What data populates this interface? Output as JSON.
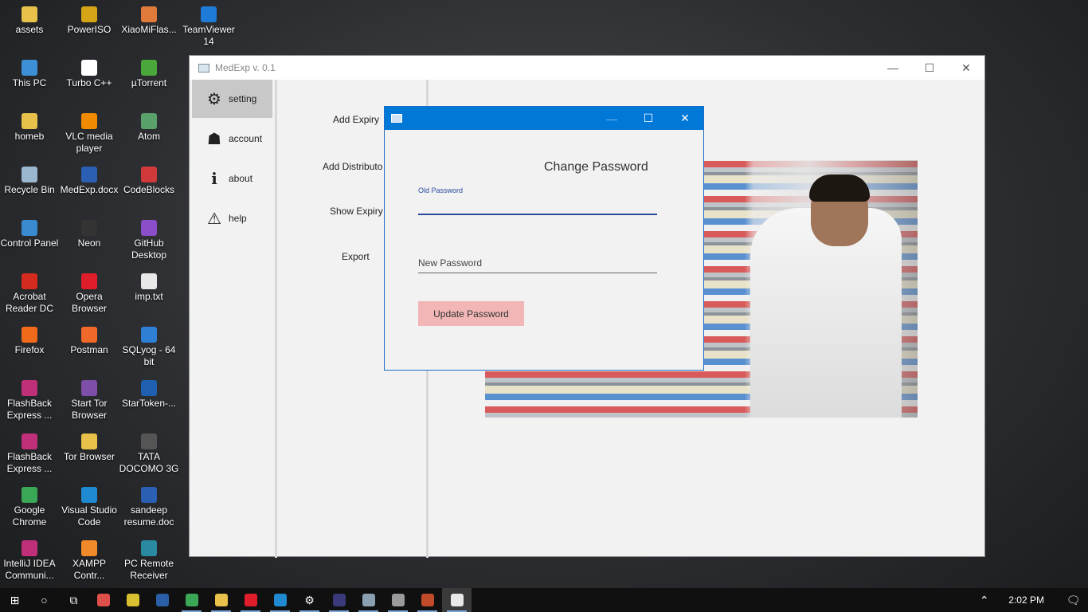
{
  "desktop": {
    "icons": [
      {
        "label": "assets",
        "color": "#e8c14a"
      },
      {
        "label": "PowerISO",
        "color": "#d6a417"
      },
      {
        "label": "XiaoMiFlas...",
        "color": "#e07a3a"
      },
      {
        "label": "TeamViewer 14",
        "color": "#1e7bd8"
      },
      {
        "label": "This PC",
        "color": "#3d8fd6"
      },
      {
        "label": "Turbo C++",
        "color": "#ffffff"
      },
      {
        "label": "µTorrent",
        "color": "#4aa83a"
      },
      {
        "label": "homeb",
        "color": "#e8c14a"
      },
      {
        "label": "VLC media player",
        "color": "#f08a00"
      },
      {
        "label": "Atom",
        "color": "#5aa06a"
      },
      {
        "label": "Recycle Bin",
        "color": "#9bb7cf"
      },
      {
        "label": "MedExp.docx",
        "color": "#2b5fb4"
      },
      {
        "label": "CodeBlocks",
        "color": "#d03a3a"
      },
      {
        "label": "Control Panel",
        "color": "#3a8ad0"
      },
      {
        "label": "Neon",
        "color": "#333333"
      },
      {
        "label": "GitHub Desktop",
        "color": "#8a4fc8"
      },
      {
        "label": "Acrobat Reader DC",
        "color": "#d42b1e"
      },
      {
        "label": "Opera Browser",
        "color": "#e01e2b"
      },
      {
        "label": "imp.txt",
        "color": "#e8e8e8"
      },
      {
        "label": "Firefox",
        "color": "#f06a1a"
      },
      {
        "label": "Postman",
        "color": "#f0682a"
      },
      {
        "label": "SQLyog - 64 bit",
        "color": "#2f7fd6"
      },
      {
        "label": "FlashBack Express ...",
        "color": "#c0307a"
      },
      {
        "label": "Start Tor Browser",
        "color": "#7d4fa8"
      },
      {
        "label": "StarToken-...",
        "color": "#1e5fb0"
      },
      {
        "label": "FlashBack Express ...",
        "color": "#c0307a"
      },
      {
        "label": "Tor Browser",
        "color": "#e8c14a"
      },
      {
        "label": "TATA DOCOMO 3G",
        "color": "#555555"
      },
      {
        "label": "Google Chrome",
        "color": "#3aa757"
      },
      {
        "label": "Visual Studio Code",
        "color": "#1f8ad2"
      },
      {
        "label": "sandeep resume.doc",
        "color": "#2b5fb4"
      },
      {
        "label": "IntelliJ IDEA Communi...",
        "color": "#c0307a"
      },
      {
        "label": "XAMPP Contr...",
        "color": "#f08a2a"
      },
      {
        "label": "PC Remote Receiver",
        "color": "#2a8aa0"
      }
    ]
  },
  "app": {
    "title": "MedExp v. 0.1",
    "sidebar": [
      {
        "label": "setting",
        "icon": "gears-icon",
        "glyph": "⚙"
      },
      {
        "label": "account",
        "icon": "user-spy-icon",
        "glyph": "☗"
      },
      {
        "label": "about",
        "icon": "info-icon",
        "glyph": "i"
      },
      {
        "label": "help",
        "icon": "warning-icon",
        "glyph": "⚠"
      }
    ],
    "menu": {
      "add_expiry": "Add Expiry",
      "add_distributor": "Add Distributo",
      "show_expiry": "Show Expiry",
      "export": "Export"
    },
    "window_buttons": {
      "minimize": "—",
      "maximize": "☐",
      "close": "✕"
    }
  },
  "dialog": {
    "heading": "Change Password",
    "old_password": {
      "label": "Old Password",
      "value": ""
    },
    "new_password": {
      "placeholder": "New Password",
      "value": ""
    },
    "update_button": "Update Password",
    "window_buttons": {
      "minimize": "—",
      "maximize": "☐",
      "close": "✕"
    }
  },
  "taskbar": {
    "clock": "2:02 PM",
    "apps": [
      {
        "name": "start-button",
        "glyph": "⊞"
      },
      {
        "name": "cortana-button",
        "glyph": "○"
      },
      {
        "name": "task-view-button",
        "glyph": "⧉"
      },
      {
        "name": "taskbar-app-1",
        "color": "#e0504a"
      },
      {
        "name": "taskbar-app-2",
        "color": "#d8c030"
      },
      {
        "name": "taskbar-app-powershell",
        "color": "#2a5fa8"
      },
      {
        "name": "taskbar-app-chrome",
        "color": "#3aa757"
      },
      {
        "name": "taskbar-app-explorer",
        "color": "#e8c14a"
      },
      {
        "name": "taskbar-app-opera",
        "color": "#e01e2b"
      },
      {
        "name": "taskbar-app-vscode",
        "color": "#1f8ad2"
      },
      {
        "name": "taskbar-app-settings",
        "glyph": "⚙"
      },
      {
        "name": "taskbar-app-eclipse",
        "color": "#3a3a7a"
      },
      {
        "name": "taskbar-app-medexp",
        "color": "#8aa0b0"
      },
      {
        "name": "taskbar-app-database",
        "color": "#9a9a9a"
      },
      {
        "name": "taskbar-app-browser",
        "color": "#c04a2a"
      },
      {
        "name": "taskbar-app-java",
        "color": "#e8e8e8"
      }
    ],
    "tray_chevron": "⌃",
    "notification_glyph": "🗨"
  }
}
